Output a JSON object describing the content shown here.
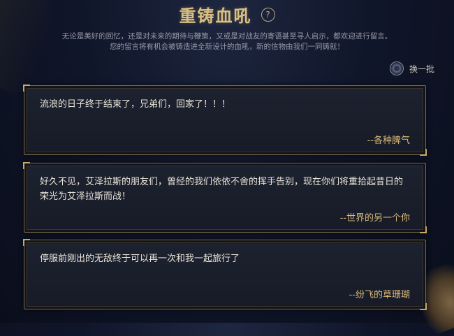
{
  "header": {
    "title": "重铸血吼",
    "help_icon": "question-circle-icon",
    "desc_line1": "无论是美好的回忆，还是对未来的期待与鞭策，又或是对战友的寄语甚至寻人启示，都欢迎进行留言。",
    "desc_line2": "您的留言将有机会被铸造进全新设计的血吼，新的信物由我们一同铸就！"
  },
  "refresh": {
    "label": "换一批",
    "icon": "refresh-orb-icon"
  },
  "messages": [
    {
      "text": "流浪的日子终于结束了，兄弟们，回家了！！！",
      "signature": "--各种脾气"
    },
    {
      "text": "好久不见，艾泽拉斯的朋友们，曾经的我们依依不舍的挥手告别，现在你们将重拾起昔日的荣光为艾泽拉斯而战！",
      "signature": "--世界的另一个你"
    },
    {
      "text": "停服前刚出的无敌终于可以再一次和我一起旅行了",
      "signature": "--纷飞的草珊瑚"
    }
  ],
  "colors": {
    "gold": "#d8bf86",
    "signature": "#d9b978",
    "background": "#10162a"
  }
}
